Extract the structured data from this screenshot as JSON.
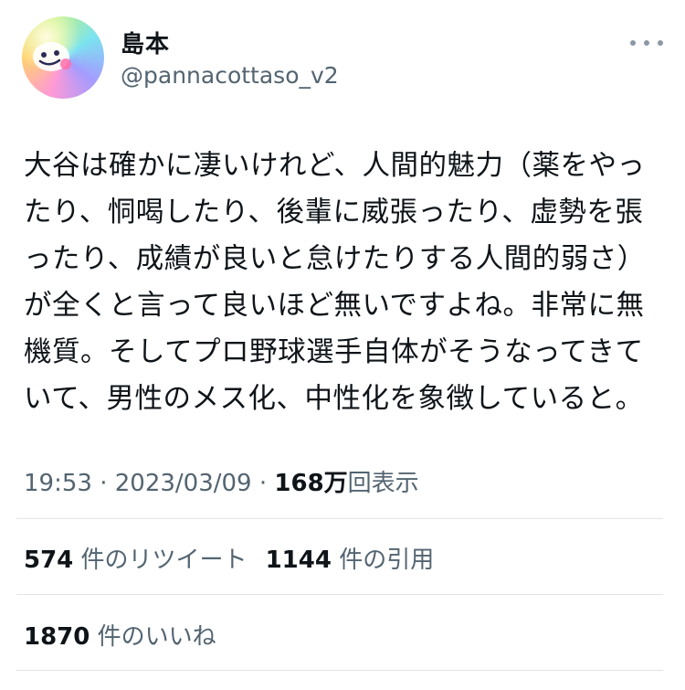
{
  "author": {
    "name": "島本",
    "handle": "@pannacottaso_v2"
  },
  "tweet": {
    "text": "大谷は確かに凄いけれど、人間的魅力（薬をやったり、恫喝したり、後輩に威張ったり、虚勢を張ったり、成績が良いと怠けたりする人間的弱さ）が全くと言って良いほど無いですよね。非常に無機質。そしてプロ野球選手自体がそうなってきていて、男性のメス化、中性化を象徴していると。"
  },
  "meta": {
    "time": "19:53",
    "separator": " · ",
    "date": "2023/03/09",
    "views_count": "168万",
    "views_label": "回表示"
  },
  "stats": {
    "retweets_count": "574",
    "retweets_label": "件のリツイート",
    "quotes_count": "1144",
    "quotes_label": "件の引用",
    "likes_count": "1870",
    "likes_label": "件のいいね"
  },
  "colors": {
    "text_primary": "#0f1419",
    "text_secondary": "#536471",
    "divider": "#e1e4e8"
  },
  "icons": {
    "more": "more-horizontal-icon",
    "avatar": "smiley-face"
  }
}
